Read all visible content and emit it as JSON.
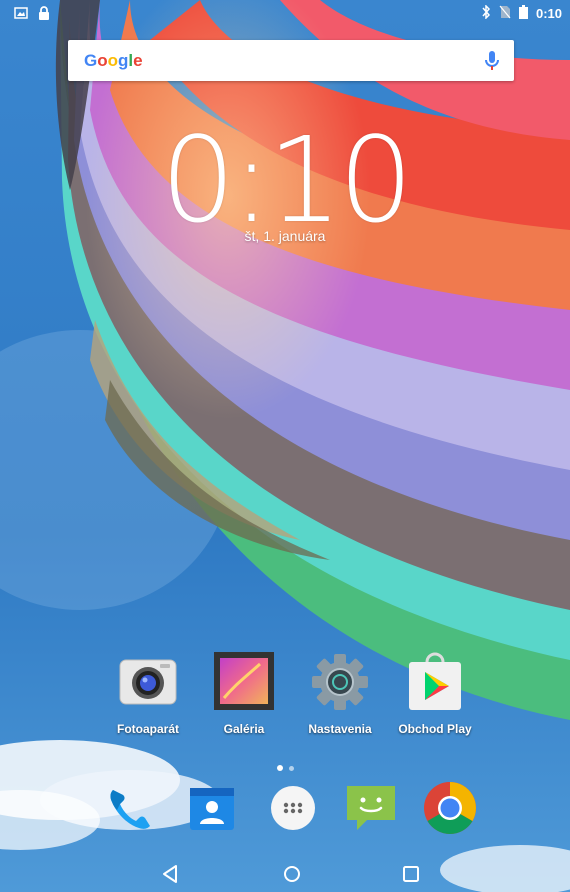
{
  "status_bar": {
    "time": "0:10",
    "left_icons": [
      "image-notification-icon",
      "lock-icon"
    ],
    "right_icons": [
      "bluetooth-icon",
      "no-sim-icon",
      "battery-icon"
    ]
  },
  "search": {
    "logo_text": "Google",
    "logo_colors": [
      "#4285F4",
      "#EA4335",
      "#FBBC05",
      "#4285F4",
      "#34A853",
      "#EA4335"
    ],
    "mic_color": "#4285F4"
  },
  "clock": {
    "time": "0:10",
    "date": "št, 1. januára"
  },
  "apps": [
    {
      "label": "Fotoaparát",
      "icon": "camera-icon"
    },
    {
      "label": "Galéria",
      "icon": "gallery-icon"
    },
    {
      "label": "Nastavenia",
      "icon": "settings-icon"
    },
    {
      "label": "Obchod Play",
      "icon": "play-store-icon"
    }
  ],
  "dock": [
    {
      "icon": "phone-icon"
    },
    {
      "icon": "contacts-icon"
    },
    {
      "icon": "app-drawer-icon"
    },
    {
      "icon": "messaging-icon"
    },
    {
      "icon": "chrome-icon"
    }
  ],
  "page_indicator": {
    "pages": 2,
    "current": 1
  },
  "nav": [
    "back-icon",
    "home-icon",
    "recents-icon"
  ]
}
